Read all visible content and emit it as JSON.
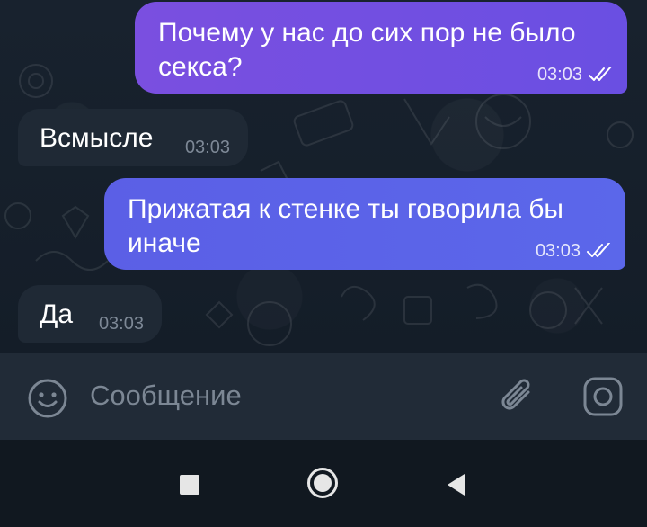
{
  "messages": [
    {
      "direction": "outgoing",
      "text_line1": "Почему у нас до сих пор не было",
      "text_line2": "секса?",
      "time": "03:03",
      "status": "read"
    },
    {
      "direction": "incoming",
      "text": "Всмысле",
      "time": "03:03"
    },
    {
      "direction": "outgoing",
      "text_line1": "Прижатая к стенке ты говорила бы",
      "text_line2": "иначе",
      "time": "03:03",
      "status": "read"
    },
    {
      "direction": "incoming",
      "text": "Да",
      "time": "03:03"
    }
  ],
  "composer": {
    "placeholder": "Сообщение",
    "value": "",
    "emoji_icon": "emoji-icon",
    "attach_icon": "paperclip-icon",
    "camera_icon": "camera-icon"
  },
  "navigation": {
    "recents_icon": "square-icon",
    "home_icon": "circle-icon",
    "back_icon": "triangle-back-icon"
  },
  "colors": {
    "chat_background": "#141d28",
    "outgoing_bubble_1": "#7a4fe0",
    "outgoing_bubble_2": "#5b63e8",
    "incoming_bubble": "#1f2935",
    "input_bar": "#212b37",
    "nav_bar": "#111820"
  }
}
